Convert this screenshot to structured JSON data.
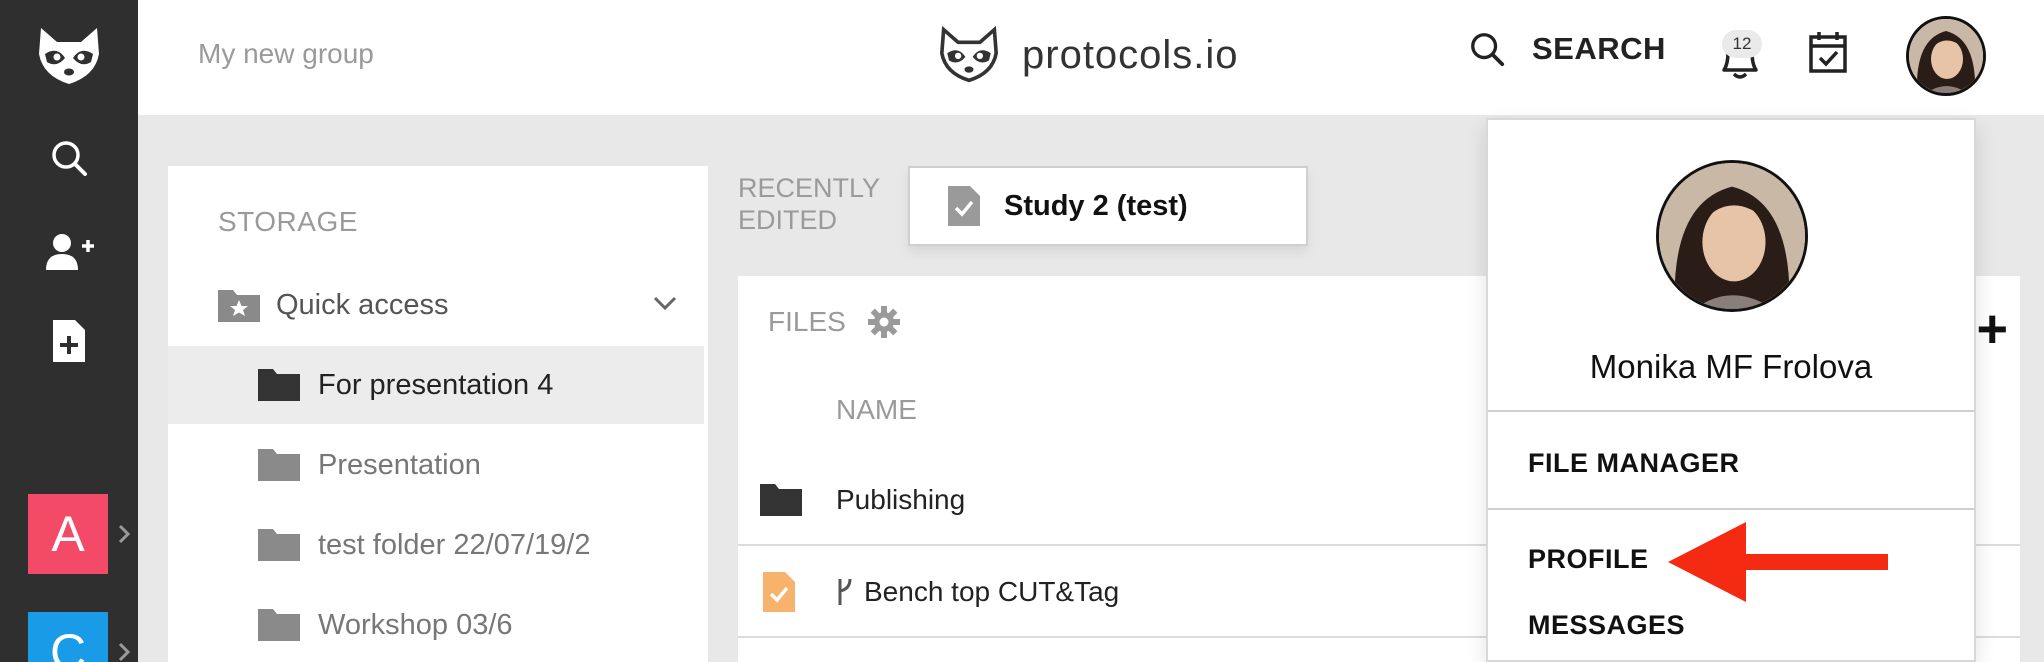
{
  "left_rail": {
    "icons": [
      "raccoon-logo-icon",
      "search-icon",
      "add-user-icon",
      "add-file-icon"
    ],
    "workspaces": [
      {
        "letter": "A",
        "color": "#f24a67"
      },
      {
        "letter": "C",
        "color": "#1a9be8"
      }
    ]
  },
  "header": {
    "group_name": "My new group",
    "brand": "protocols.io",
    "search_label": "SEARCH",
    "notification_count": "12"
  },
  "storage": {
    "title": "STORAGE",
    "quick_access_label": "Quick access",
    "folders": [
      {
        "label": "For presentation 4",
        "active": true
      },
      {
        "label": "Presentation",
        "active": false
      },
      {
        "label": "test folder 22/07/19/2",
        "active": false
      },
      {
        "label": "Workshop 03/6",
        "active": false
      }
    ]
  },
  "recently_edited": {
    "label_line1": "RECENTLY",
    "label_line2": "EDITED",
    "item": "Study 2 (test)"
  },
  "files": {
    "title": "FILES",
    "column_name": "NAME",
    "rows": [
      {
        "type": "folder",
        "name": "Publishing"
      },
      {
        "type": "protocol",
        "name": "Bench top CUT&Tag"
      }
    ]
  },
  "user_menu": {
    "user_name": "Monika MF Frolova",
    "items": [
      "FILE MANAGER",
      "PROFILE",
      "MESSAGES"
    ]
  },
  "colors": {
    "rail": "#2f2f2f",
    "arrow": "#f52a12",
    "protocol_icon": "#f7b36b"
  }
}
